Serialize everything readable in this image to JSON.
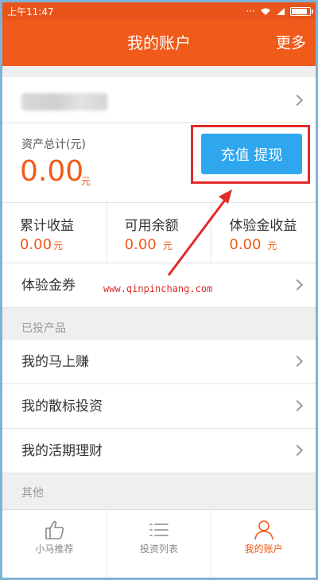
{
  "status_bar": {
    "time": "上午11:47",
    "dots": "···"
  },
  "header": {
    "title": "我的账户",
    "more_label": "更多"
  },
  "asset": {
    "label": "资产总计(元)",
    "amount": "0.00",
    "unit": "元",
    "action_label": "充值 提现"
  },
  "stats": [
    {
      "label": "累计收益",
      "value": "0.00",
      "unit": "元"
    },
    {
      "label": "可用余额",
      "value": "0.00",
      "unit": "元"
    },
    {
      "label": "体验金收益",
      "value": "0.00",
      "unit": "元"
    }
  ],
  "coupon_row": {
    "label": "体验金券"
  },
  "watermark": "www.qinpinchang.com",
  "invested_section": {
    "title": "已投产品",
    "items": [
      {
        "label": "我的马上赚"
      },
      {
        "label": "我的散标投资"
      },
      {
        "label": "我的活期理财"
      }
    ]
  },
  "other_section": {
    "title": "其他"
  },
  "tabbar": [
    {
      "label": "小马推荐",
      "icon": "thumbs-up-icon",
      "active": false
    },
    {
      "label": "投资列表",
      "icon": "list-icon",
      "active": false
    },
    {
      "label": "我的账户",
      "icon": "user-icon",
      "active": true
    }
  ],
  "colors": {
    "brand_orange": "#f05a1a",
    "action_blue": "#2fa7ee",
    "annotation_red": "#e02b2b"
  }
}
